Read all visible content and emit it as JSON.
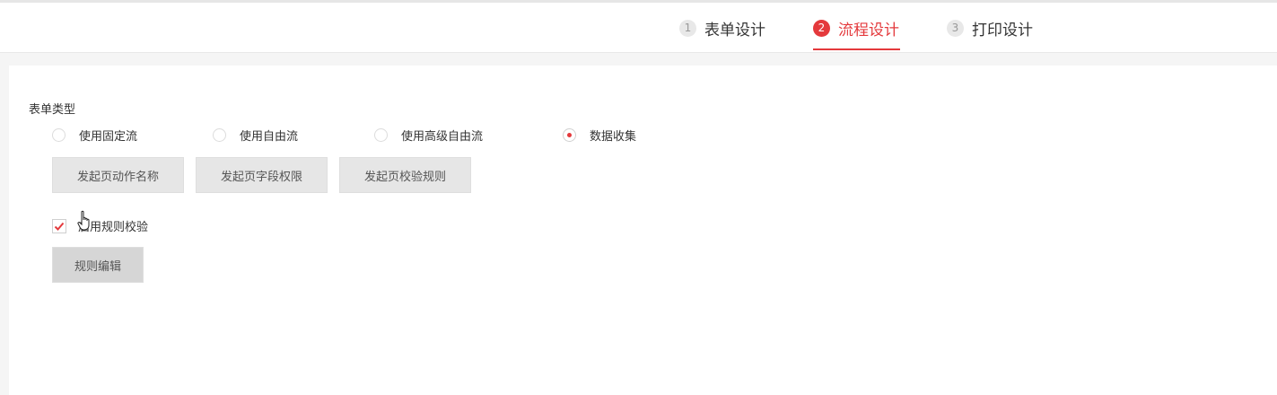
{
  "steps": [
    {
      "num": "1",
      "label": "表单设计",
      "active": false
    },
    {
      "num": "2",
      "label": "流程设计",
      "active": true
    },
    {
      "num": "3",
      "label": "打印设计",
      "active": false
    }
  ],
  "form_type": {
    "label": "表单类型",
    "options": [
      {
        "label": "使用固定流",
        "checked": false
      },
      {
        "label": "使用自由流",
        "checked": false
      },
      {
        "label": "使用高级自由流",
        "checked": false
      },
      {
        "label": "数据收集",
        "checked": true
      }
    ]
  },
  "buttons": {
    "action_name": "发起页动作名称",
    "field_permission": "发起页字段权限",
    "validation_rule": "发起页校验规则",
    "rule_edit": "规则编辑"
  },
  "rule_check": {
    "label": "启用规则校验",
    "checked": true
  },
  "colors": {
    "accent": "#e4393c",
    "button_bg": "#e6e6e6"
  }
}
